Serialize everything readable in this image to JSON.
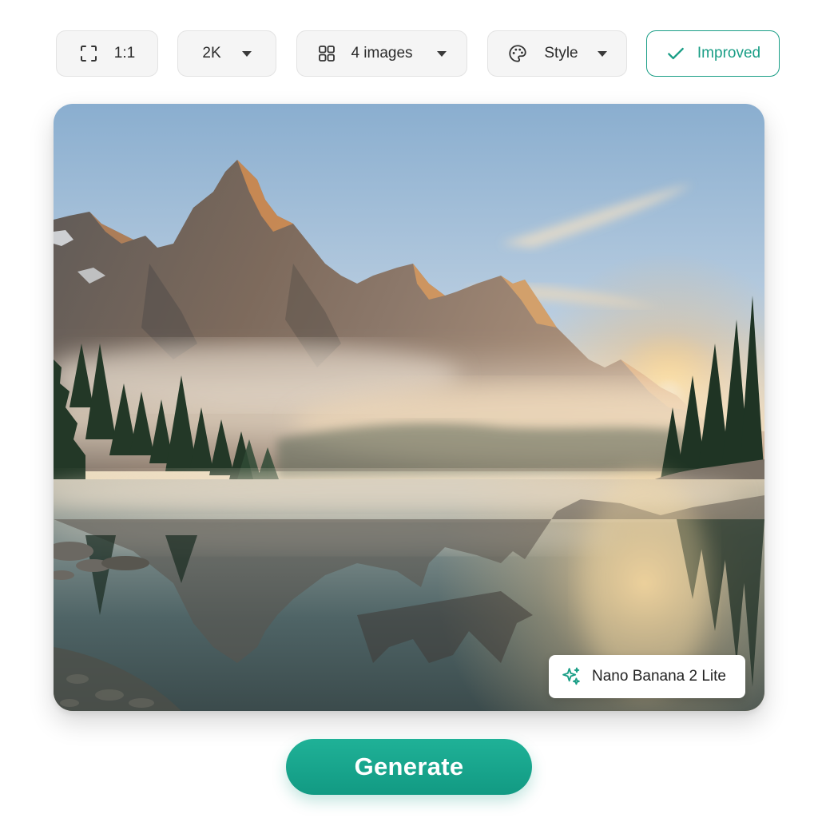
{
  "toolbar": {
    "aspect_ratio": {
      "label": "1:1",
      "icon": "aspect-ratio-icon"
    },
    "resolution": {
      "label": "2K",
      "icon": "chevron-down-icon"
    },
    "image_count": {
      "label": "4 images",
      "icon": "grid-icon"
    },
    "style": {
      "label": "Style",
      "icon": "palette-icon"
    },
    "improved": {
      "label": "Improved",
      "icon": "check-icon",
      "active": true
    }
  },
  "preview": {
    "model_badge": {
      "label": "Nano Banana 2 Lite",
      "icon": "sparkle-icon"
    }
  },
  "generate": {
    "label": "Generate"
  },
  "colors": {
    "accent": "#1a9e86",
    "button": "#16a58c",
    "pill_bg": "#f5f5f5",
    "pill_border": "#e3e3e3"
  }
}
